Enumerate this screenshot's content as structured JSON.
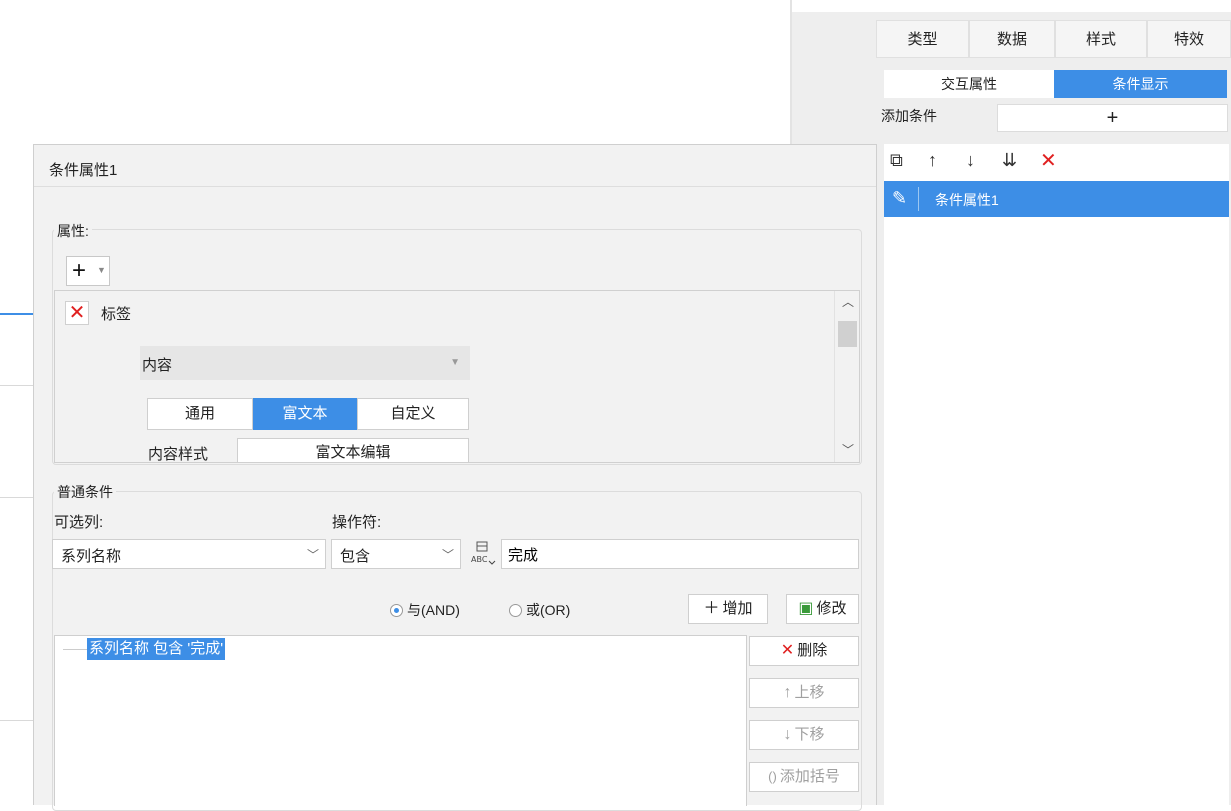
{
  "right_panel": {
    "top_tabs": [
      "类型",
      "数据",
      "样式",
      "特效"
    ],
    "sub_tabs": [
      "交互属性",
      "条件显示"
    ],
    "add_condition_label": "添加条件",
    "add_condition_button": "+",
    "condition_items": [
      "条件属性1"
    ]
  },
  "dialog": {
    "title": "条件属性1",
    "properties": {
      "legend": "属性:",
      "add_button": "+",
      "item_label": "标签",
      "content_select": "内容",
      "segments": [
        "通用",
        "富文本",
        "自定义"
      ],
      "active_segment": "富文本",
      "style_label": "内容样式",
      "style_button": "富文本编辑"
    },
    "normal_condition": {
      "legend": "普通条件",
      "column_label": "可选列:",
      "column_value": "系列名称",
      "operator_label": "操作符:",
      "operator_value": "包含",
      "value": "完成"
    },
    "logic": {
      "and_label": "与(AND)",
      "or_label": "或(OR)",
      "selected": "and"
    },
    "actions": {
      "add": "增加",
      "modify": "修改",
      "delete": "删除",
      "move_up": "上移",
      "move_down": "下移",
      "add_bracket": "添加括号"
    },
    "condition_tree": [
      "系列名称 包含 '完成'"
    ]
  }
}
